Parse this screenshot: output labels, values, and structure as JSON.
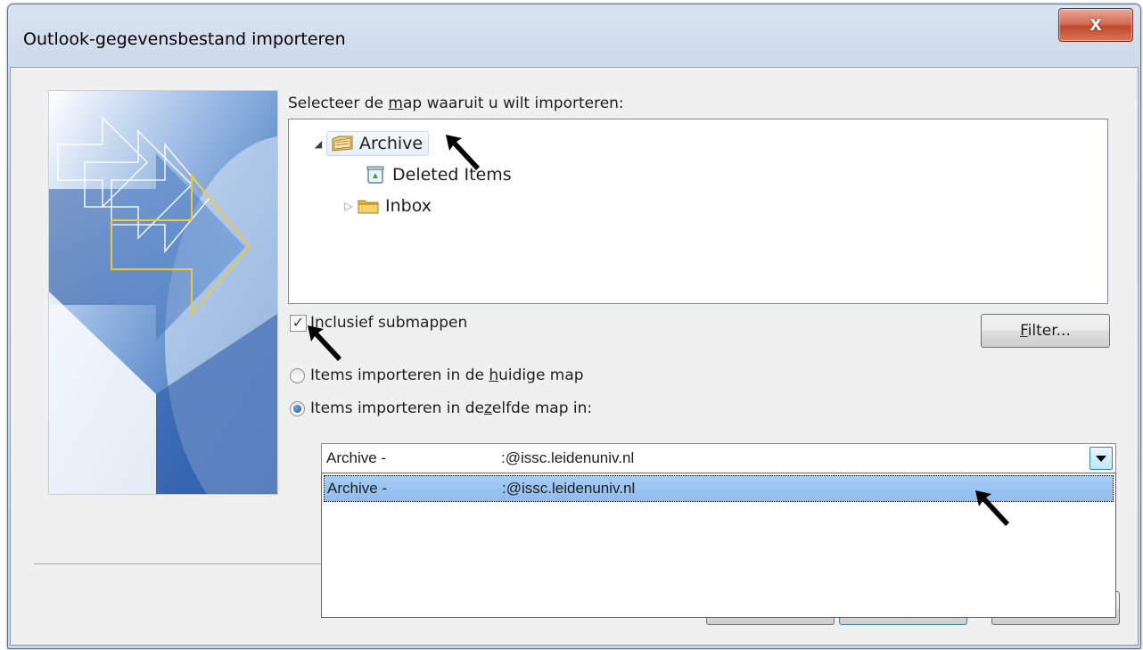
{
  "window": {
    "title": "Outlook-gegevensbestand importeren",
    "close_glyph": "x"
  },
  "prompt": {
    "before": "Selecteer de ",
    "accel": "m",
    "after": "ap waaruit u wilt importeren:"
  },
  "tree": {
    "items": [
      {
        "label": "Archive",
        "icon": "pst-archive-icon",
        "expander": "expanded",
        "selected": true
      },
      {
        "label": "Deleted Items",
        "icon": "recycle-bin-icon"
      },
      {
        "label": "Inbox",
        "icon": "folder-icon",
        "expander": "collapsed"
      }
    ]
  },
  "include_subfolders": {
    "accel": "I",
    "rest": "nclusief submappen",
    "checked": true
  },
  "filter_button": {
    "accel": "F",
    "rest": "ilter..."
  },
  "radio_current": {
    "before": "Items importeren in de ",
    "accel": "h",
    "after": "uidige map",
    "selected": false
  },
  "radio_same": {
    "before": "Items importeren in de",
    "accel": "z",
    "after": "elfde map in:",
    "selected": true
  },
  "combo": {
    "value_left": "Archive -",
    "value_right": ":@issc.leidenuniv.nl"
  },
  "dropdown": {
    "options": [
      {
        "left": "Archive -",
        "right": ":@issc.leidenuniv.nl",
        "selected": true
      }
    ]
  },
  "colors": {
    "title_bg": "#cfdcec",
    "client_bg": "#f0f0f0",
    "close_red": "#c04a2c",
    "selection_blue": "#99c4f2"
  }
}
